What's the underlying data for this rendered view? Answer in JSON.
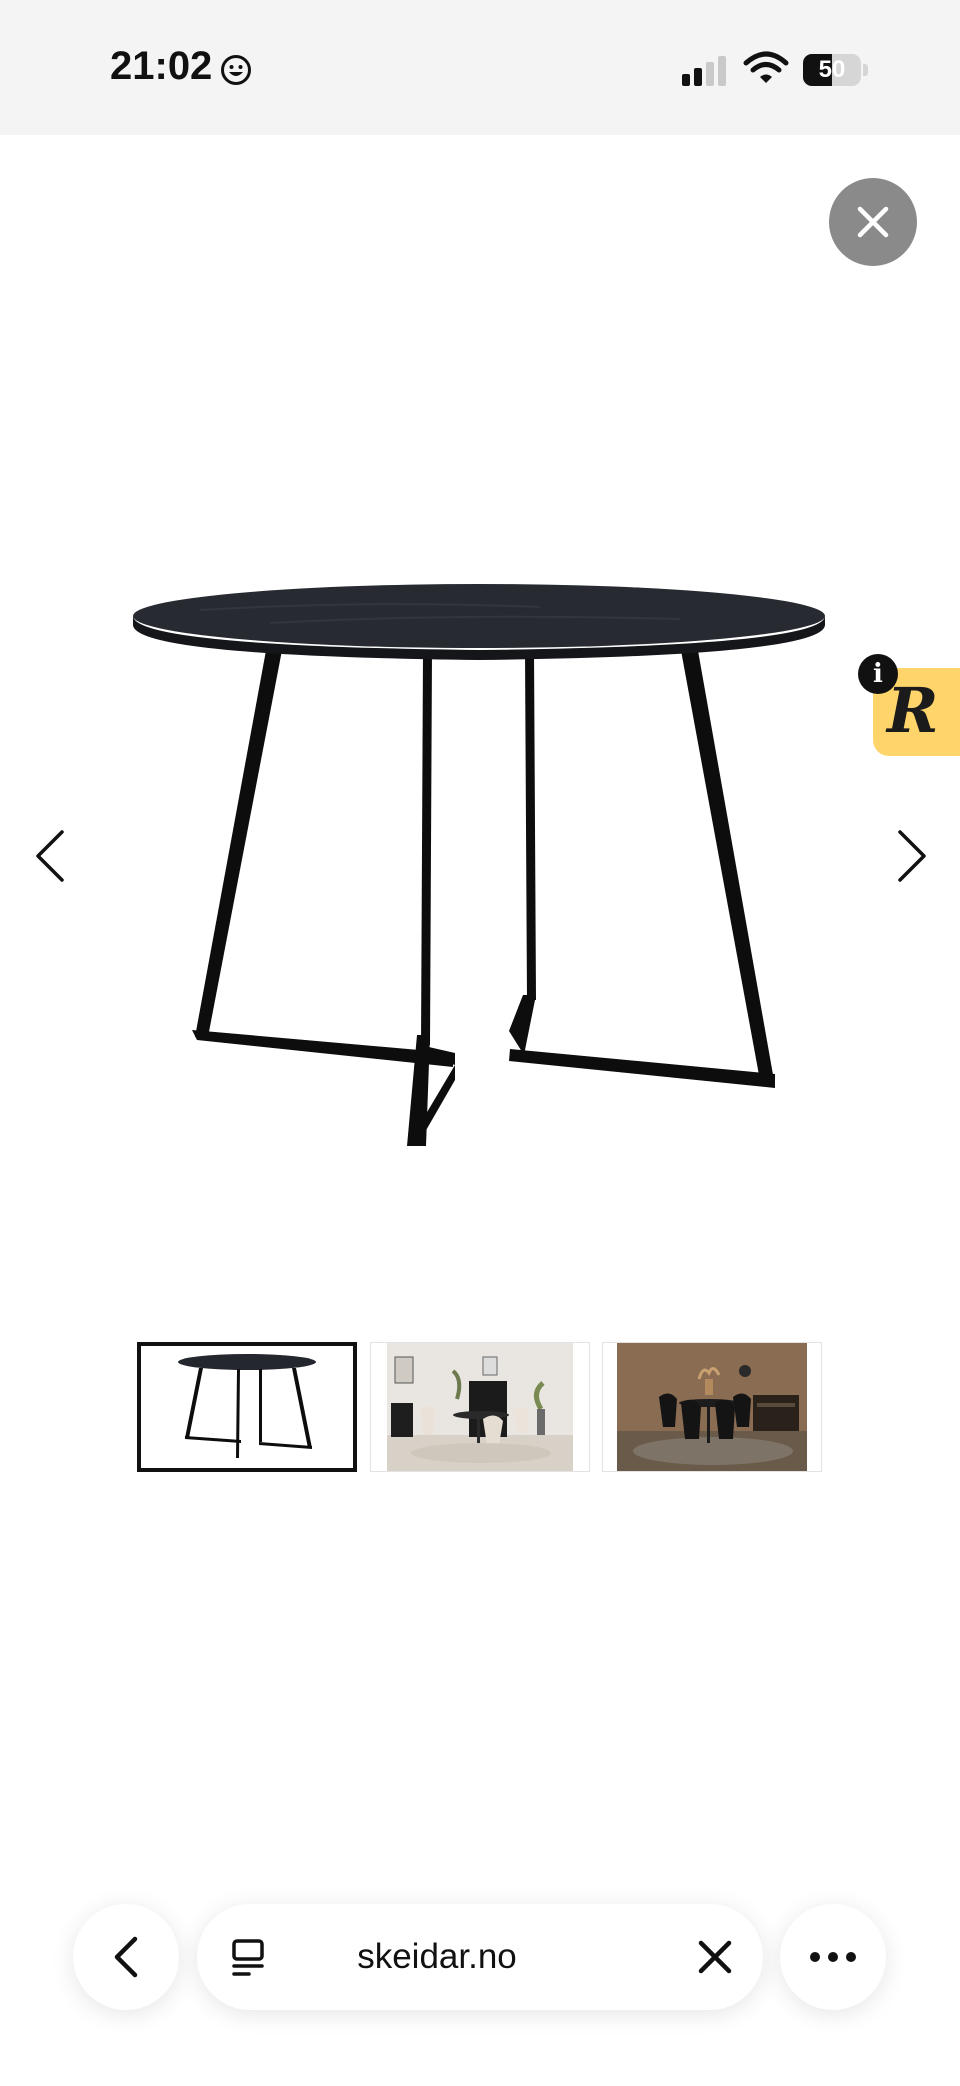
{
  "status_bar": {
    "time": "21:02",
    "battery_level": "50",
    "emoji_icon": "smiling-face-icon",
    "signal_icon": "cellular-signal-icon",
    "wifi_icon": "wifi-icon"
  },
  "viewer": {
    "close_icon": "close-icon",
    "prev_icon": "chevron-left-icon",
    "next_icon": "chevron-right-icon",
    "product_image": "round black dining table with angled black legs",
    "selected_thumbnail": 1,
    "thumbnails": [
      {
        "subject": "round black table on white background"
      },
      {
        "subject": "dining room with light chairs"
      },
      {
        "subject": "dining room with black chairs on brown wall"
      }
    ]
  },
  "badge": {
    "letter": "R",
    "info_letter": "i",
    "color": "#ffd46a"
  },
  "browser_bar": {
    "back_icon": "chevron-left-icon",
    "tabs_icon": "tabs-icon",
    "url": "skeidar.no",
    "clear_icon": "close-icon",
    "more_icon": "more-dots-icon"
  }
}
